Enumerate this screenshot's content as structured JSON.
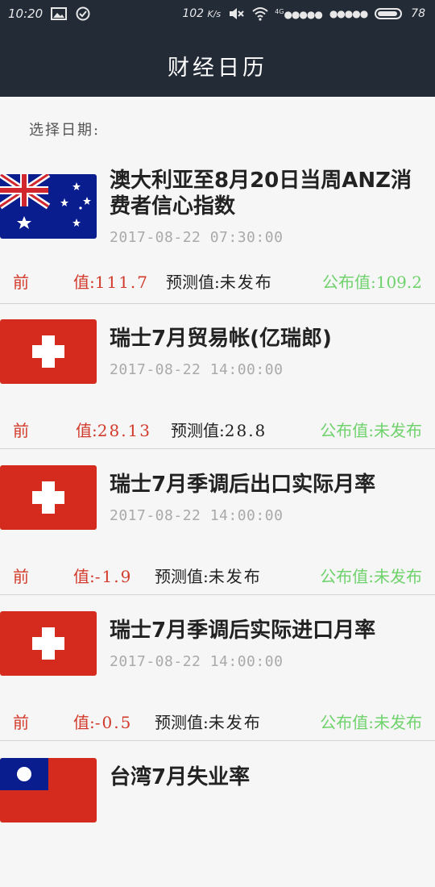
{
  "status_bar": {
    "time": "10:20",
    "speed": "102",
    "speed_unit": "K/s",
    "network": "4G",
    "battery": "78"
  },
  "header": {
    "title": "财经日历"
  },
  "date_picker": {
    "label": "选择日期:"
  },
  "labels": {
    "previous": "前",
    "previous_suffix": "值:",
    "forecast": "预测值:",
    "published": "公布值:"
  },
  "items": [
    {
      "flag": "australia-flag",
      "title": "澳大利亚至8月20日当周ANZ消费者信心指数",
      "time": "2017-08-22 07:30:00",
      "previous": "111.7",
      "forecast": "未发布",
      "published": "109.2"
    },
    {
      "flag": "switzerland-flag",
      "title": "瑞士7月贸易帐(亿瑞郎)",
      "time": "2017-08-22 14:00:00",
      "previous": "28.13",
      "forecast": "28.8",
      "published": "未发布"
    },
    {
      "flag": "switzerland-flag",
      "title": "瑞士7月季调后出口实际月率",
      "time": "2017-08-22 14:00:00",
      "previous": "-1.9",
      "forecast": "未发布",
      "published": "未发布"
    },
    {
      "flag": "switzerland-flag",
      "title": "瑞士7月季调后实际进口月率",
      "time": "2017-08-22 14:00:00",
      "previous": "-0.5",
      "forecast": "未发布",
      "published": "未发布"
    },
    {
      "flag": "taiwan-flag",
      "title": "台湾7月失业率"
    }
  ],
  "colors": {
    "header_bg": "#232b37",
    "previous": "#d23a2b",
    "published": "#6fd26c",
    "swiss_red": "#d52b1e"
  }
}
